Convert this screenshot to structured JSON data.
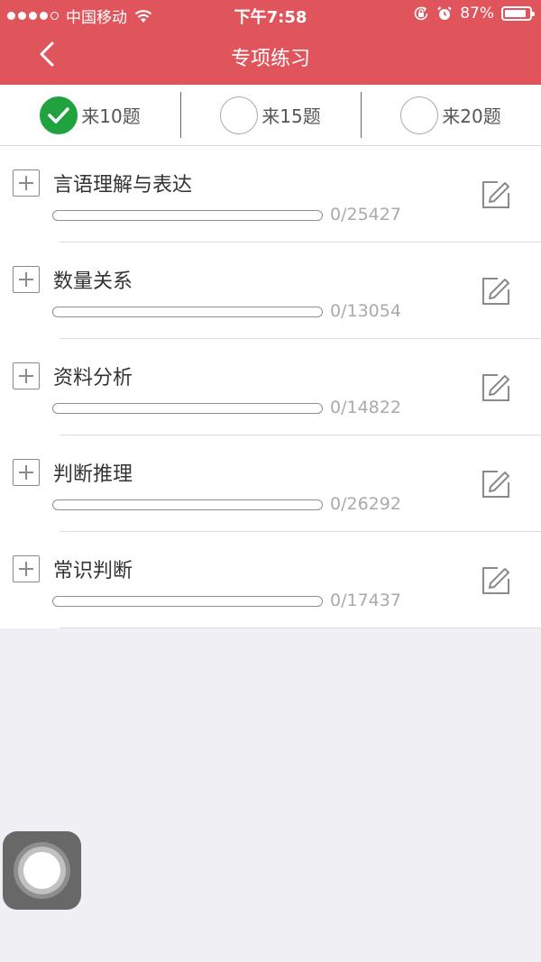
{
  "status_bar": {
    "carrier": "中国移动",
    "time": "下午7:58",
    "battery_percent": "87%",
    "battery_level": 0.87,
    "signal_bars": 4
  },
  "nav": {
    "title": "专项练习",
    "back_icon": "chevron-left-icon"
  },
  "question_count": {
    "options": [
      {
        "label": "来10题",
        "selected": true
      },
      {
        "label": "来15题",
        "selected": false
      },
      {
        "label": "来20题",
        "selected": false
      }
    ]
  },
  "categories": [
    {
      "title": "言语理解与表达",
      "progress": "0/25427",
      "done": 0,
      "total": 25427
    },
    {
      "title": "数量关系",
      "progress": "0/13054",
      "done": 0,
      "total": 13054
    },
    {
      "title": "资料分析",
      "progress": "0/14822",
      "done": 0,
      "total": 14822
    },
    {
      "title": "判断推理",
      "progress": "0/26292",
      "done": 0,
      "total": 26292
    },
    {
      "title": "常识判断",
      "progress": "0/17437",
      "done": 0,
      "total": 17437
    }
  ],
  "colors": {
    "accent": "#e0555c",
    "selected": "#20a33e",
    "background": "#efeff4"
  }
}
